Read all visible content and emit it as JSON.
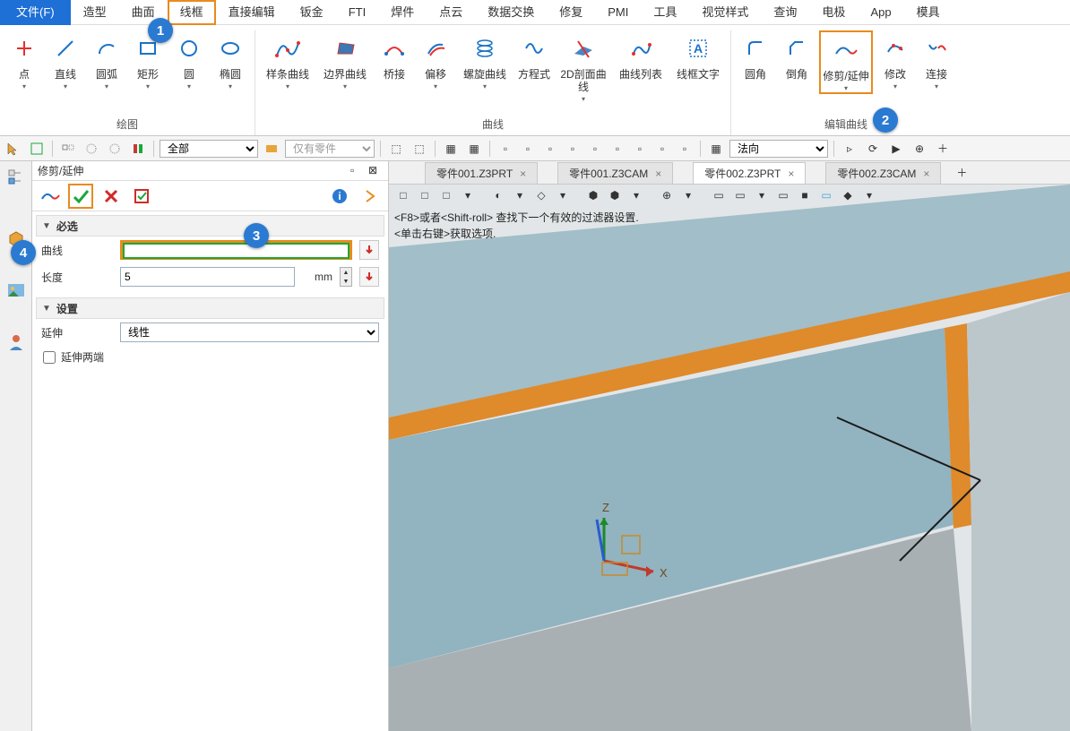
{
  "menu": {
    "file": "文件(F)",
    "items": [
      "造型",
      "曲面",
      "线框",
      "直接编辑",
      "钣金",
      "FTI",
      "焊件",
      "点云",
      "数据交换",
      "修复",
      "PMI",
      "工具",
      "视觉样式",
      "查询",
      "电极",
      "App",
      "模具"
    ]
  },
  "ribbon": {
    "groups": [
      {
        "title": "绘图",
        "buttons": [
          {
            "label": "点",
            "icon": "plus",
            "arrow": true
          },
          {
            "label": "直线",
            "icon": "line",
            "arrow": true
          },
          {
            "label": "圆弧",
            "icon": "arc",
            "arrow": true
          },
          {
            "label": "矩形",
            "icon": "rect",
            "arrow": true
          },
          {
            "label": "圆",
            "icon": "circle",
            "arrow": true
          },
          {
            "label": "椭圆",
            "icon": "ellipse",
            "arrow": true
          }
        ]
      },
      {
        "title": "曲线",
        "buttons": [
          {
            "label": "样条曲线",
            "icon": "spline",
            "arrow": true,
            "wide": true
          },
          {
            "label": "边界曲线",
            "icon": "boundary",
            "arrow": true,
            "wide": true
          },
          {
            "label": "桥接",
            "icon": "bridge",
            "arrow": false
          },
          {
            "label": "偏移",
            "icon": "offset",
            "arrow": true
          },
          {
            "label": "螺旋曲线",
            "icon": "helix",
            "arrow": true,
            "wide": true
          },
          {
            "label": "方程式",
            "icon": "equation",
            "arrow": false
          },
          {
            "label": "2D剖面曲线",
            "icon": "section",
            "arrow": true,
            "wide": true
          },
          {
            "label": "曲线列表",
            "icon": "curvelist",
            "arrow": false,
            "wide": true
          },
          {
            "label": "线框文字",
            "icon": "text",
            "arrow": false,
            "wide": true
          }
        ]
      },
      {
        "title": "编辑曲线",
        "buttons": [
          {
            "label": "圆角",
            "icon": "fillet",
            "arrow": false
          },
          {
            "label": "倒角",
            "icon": "chamfer",
            "arrow": false
          },
          {
            "label": "修剪/延伸",
            "icon": "trimext",
            "arrow": true,
            "hl": true
          },
          {
            "label": "修改",
            "icon": "modify",
            "arrow": true
          },
          {
            "label": "连接",
            "icon": "connect",
            "arrow": true
          }
        ]
      }
    ]
  },
  "quickbar": {
    "select1": "全部",
    "select2": "仅有零件",
    "select3": "法向"
  },
  "panel": {
    "title": "修剪/延伸",
    "sections": {
      "required": "必选",
      "settings": "设置"
    },
    "fields": {
      "curve_label": "曲线",
      "curve_value": "",
      "length_label": "长度",
      "length_value": "5",
      "length_unit": "mm",
      "extend_label": "延伸",
      "extend_value": "线性",
      "both_ends_label": "延伸两端"
    }
  },
  "tabs": [
    {
      "label": "零件001.Z3PRT",
      "active": false
    },
    {
      "label": "零件001.Z3CAM",
      "active": false
    },
    {
      "label": "零件002.Z3PRT",
      "active": true
    },
    {
      "label": "零件002.Z3CAM",
      "active": false
    }
  ],
  "viewport": {
    "hint1": "<F8>或者<Shift-roll> 查找下一个有效的过滤器设置.",
    "hint2": "<单击右键>获取选项.",
    "axis_x": "X",
    "axis_z": "Z"
  },
  "callouts": {
    "1": "1",
    "2": "2",
    "3": "3",
    "4": "4"
  }
}
